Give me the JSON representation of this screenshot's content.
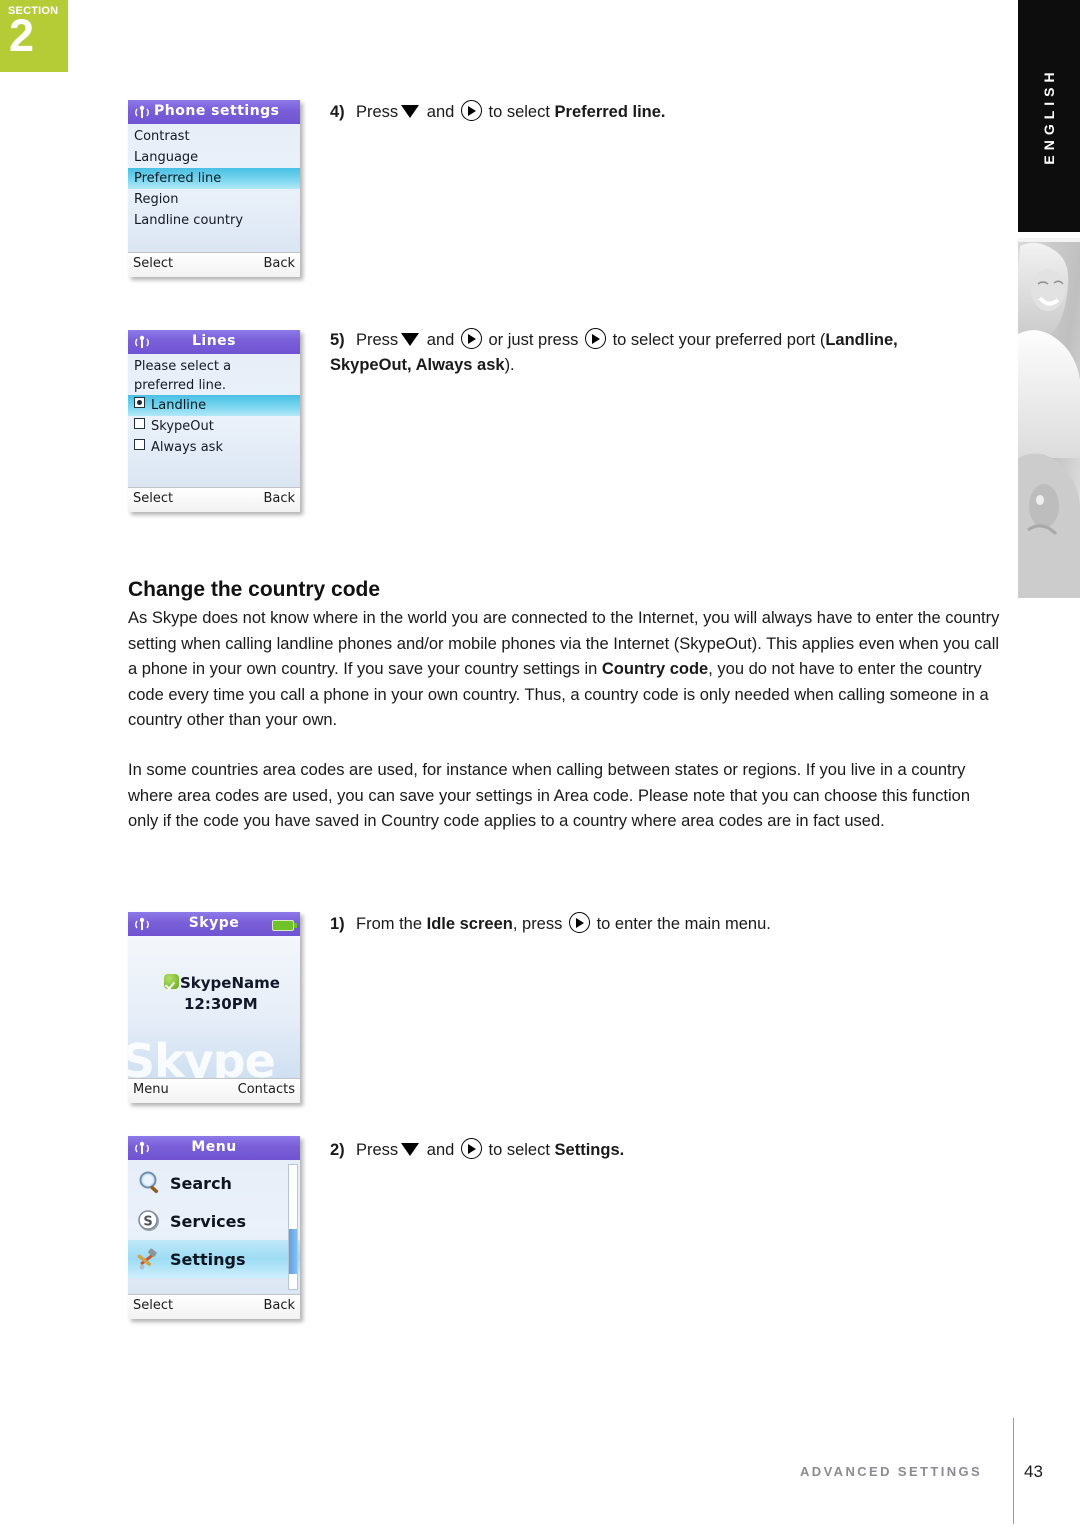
{
  "section_badge": {
    "word": "SECTION",
    "number": "2",
    "color": "#b6cc37"
  },
  "language_tab": {
    "label": "ENGLISH",
    "background": "#0d0d0d"
  },
  "side_photo": {
    "alt": "grayscale-photo-smiling-woman"
  },
  "accents": {
    "titlebar_purple": "#7a5fd8",
    "highlight_cyan": "#79d6ef",
    "battery_green": "#6fc22a",
    "status_green": "#63ab16"
  },
  "screens": {
    "phone_settings": {
      "title": "Phone settings",
      "items": [
        {
          "label": "Contrast",
          "highlighted": false
        },
        {
          "label": "Language",
          "highlighted": false
        },
        {
          "label": "Preferred line",
          "highlighted": true
        },
        {
          "label": "Region",
          "highlighted": false
        },
        {
          "label": "Landline country",
          "highlighted": false
        }
      ],
      "softkey_left": "Select",
      "softkey_right": "Back"
    },
    "lines": {
      "title": "Lines",
      "intro_line1": "Please select a",
      "intro_line2": "preferred line.",
      "options": [
        {
          "label": "Landline",
          "selected": true
        },
        {
          "label": "SkypeOut",
          "selected": false
        },
        {
          "label": "Always ask",
          "selected": false
        }
      ],
      "softkey_left": "Select",
      "softkey_right": "Back"
    },
    "idle": {
      "title": "Skype",
      "skype_name": "SkypeName",
      "time": "12:30PM",
      "watermark": "Skype",
      "softkey_left": "Menu",
      "softkey_right": "Contacts"
    },
    "menu": {
      "title": "Menu",
      "items": [
        {
          "label": "Search",
          "icon": "magnifier-icon",
          "highlighted": false
        },
        {
          "label": "Services",
          "icon": "skype-s-icon",
          "highlighted": false
        },
        {
          "label": "Settings",
          "icon": "tools-icon",
          "highlighted": true
        }
      ],
      "softkey_left": "Select",
      "softkey_right": "Back"
    }
  },
  "steps": {
    "step4": {
      "number": "4)",
      "text_a": "Press",
      "text_b": "and",
      "text_c": "to select",
      "bold_target": "Preferred line."
    },
    "step5": {
      "number": "5)",
      "text_a": "Press",
      "text_b": "and",
      "text_c": "or just press",
      "text_d": "to select your preferred port (",
      "bold_targets": "Landline, SkypeOut, Always ask",
      "text_e": ")."
    },
    "step1": {
      "number": "1)",
      "text_a": "From the",
      "bold_target": "Idle screen",
      "text_b": ", press",
      "text_c": "to enter the main menu."
    },
    "step2": {
      "number": "2)",
      "text_a": "Press",
      "text_b": "and",
      "text_c": "to select",
      "bold_target": "Settings."
    }
  },
  "content": {
    "heading": "Change the country code",
    "paragraph_1_part1": "As Skype does not know where in the world you are connected to the Internet, you will always have to enter the country setting when calling landline phones and/or mobile phones via the Internet (SkypeOut). This applies even when you call a phone in your own country. If you save your country settings in ",
    "paragraph_1_bold": "Country code",
    "paragraph_1_part2": ", you do not have to enter the country code every time you call a phone in your own country. Thus, a country code is only needed when calling someone in a country other than your own.",
    "paragraph_2": "In some countries area codes are used, for instance when calling between states or regions. If you live in a country where area codes are used, you can save your settings in Area code. Please note that you can choose this function only if the code you have saved in Country code applies to a country where area codes are in fact used."
  },
  "footer": {
    "label": "ADVANCED SETTINGS",
    "page": "43"
  }
}
